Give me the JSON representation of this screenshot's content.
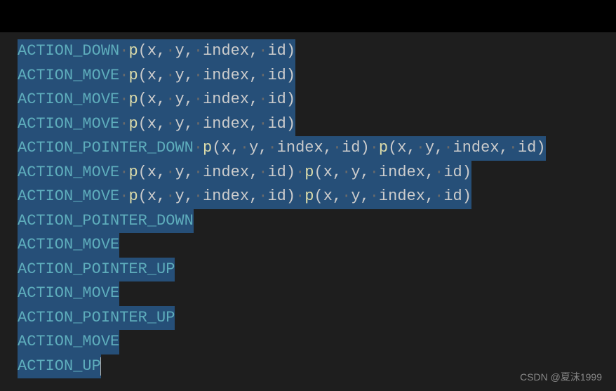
{
  "lines": [
    {
      "tokens": [
        {
          "t": "action",
          "v": "ACTION_DOWN"
        },
        {
          "t": "sp"
        },
        {
          "t": "p",
          "v": "p"
        },
        {
          "t": "params",
          "v": "(x,"
        },
        {
          "t": "sp"
        },
        {
          "t": "params",
          "v": "y,"
        },
        {
          "t": "sp"
        },
        {
          "t": "params",
          "v": "index,"
        },
        {
          "t": "sp"
        },
        {
          "t": "params",
          "v": "id)"
        }
      ]
    },
    {
      "tokens": [
        {
          "t": "action",
          "v": "ACTION_MOVE"
        },
        {
          "t": "sp"
        },
        {
          "t": "p",
          "v": "p"
        },
        {
          "t": "params",
          "v": "(x,"
        },
        {
          "t": "sp"
        },
        {
          "t": "params",
          "v": "y,"
        },
        {
          "t": "sp"
        },
        {
          "t": "params",
          "v": "index,"
        },
        {
          "t": "sp"
        },
        {
          "t": "params",
          "v": "id)"
        }
      ]
    },
    {
      "tokens": [
        {
          "t": "action",
          "v": "ACTION_MOVE"
        },
        {
          "t": "sp"
        },
        {
          "t": "p",
          "v": "p"
        },
        {
          "t": "params",
          "v": "(x,"
        },
        {
          "t": "sp"
        },
        {
          "t": "params",
          "v": "y,"
        },
        {
          "t": "sp"
        },
        {
          "t": "params",
          "v": "index,"
        },
        {
          "t": "sp"
        },
        {
          "t": "params",
          "v": "id)"
        }
      ]
    },
    {
      "tokens": [
        {
          "t": "action",
          "v": "ACTION_MOVE"
        },
        {
          "t": "sp"
        },
        {
          "t": "p",
          "v": "p"
        },
        {
          "t": "params",
          "v": "(x,"
        },
        {
          "t": "sp"
        },
        {
          "t": "params",
          "v": "y,"
        },
        {
          "t": "sp"
        },
        {
          "t": "params",
          "v": "index,"
        },
        {
          "t": "sp"
        },
        {
          "t": "params",
          "v": "id)"
        }
      ]
    },
    {
      "tokens": [
        {
          "t": "action",
          "v": "ACTION_POINTER_DOWN"
        },
        {
          "t": "sp"
        },
        {
          "t": "p",
          "v": "p"
        },
        {
          "t": "params",
          "v": "(x,"
        },
        {
          "t": "sp"
        },
        {
          "t": "params",
          "v": "y,"
        },
        {
          "t": "sp"
        },
        {
          "t": "params",
          "v": "index,"
        },
        {
          "t": "sp"
        },
        {
          "t": "params",
          "v": "id)"
        },
        {
          "t": "sp"
        },
        {
          "t": "p",
          "v": "p"
        },
        {
          "t": "params",
          "v": "(x,"
        },
        {
          "t": "sp"
        },
        {
          "t": "params",
          "v": "y,"
        },
        {
          "t": "sp"
        },
        {
          "t": "params",
          "v": "index,"
        },
        {
          "t": "sp"
        },
        {
          "t": "params",
          "v": "id)"
        }
      ]
    },
    {
      "tokens": [
        {
          "t": "action",
          "v": "ACTION_MOVE"
        },
        {
          "t": "sp"
        },
        {
          "t": "p",
          "v": "p"
        },
        {
          "t": "params",
          "v": "(x,"
        },
        {
          "t": "sp"
        },
        {
          "t": "params",
          "v": "y,"
        },
        {
          "t": "sp"
        },
        {
          "t": "params",
          "v": "index,"
        },
        {
          "t": "sp"
        },
        {
          "t": "params",
          "v": "id)"
        },
        {
          "t": "sp"
        },
        {
          "t": "p",
          "v": "p"
        },
        {
          "t": "params",
          "v": "(x,"
        },
        {
          "t": "sp"
        },
        {
          "t": "params",
          "v": "y,"
        },
        {
          "t": "sp"
        },
        {
          "t": "params",
          "v": "index,"
        },
        {
          "t": "sp"
        },
        {
          "t": "params",
          "v": "id)"
        }
      ]
    },
    {
      "tokens": [
        {
          "t": "action",
          "v": "ACTION_MOVE"
        },
        {
          "t": "sp"
        },
        {
          "t": "p",
          "v": "p"
        },
        {
          "t": "params",
          "v": "(x,"
        },
        {
          "t": "sp"
        },
        {
          "t": "params",
          "v": "y,"
        },
        {
          "t": "sp"
        },
        {
          "t": "params",
          "v": "index,"
        },
        {
          "t": "sp"
        },
        {
          "t": "params",
          "v": "id)"
        },
        {
          "t": "sp"
        },
        {
          "t": "p",
          "v": "p"
        },
        {
          "t": "params",
          "v": "(x,"
        },
        {
          "t": "sp"
        },
        {
          "t": "params",
          "v": "y,"
        },
        {
          "t": "sp"
        },
        {
          "t": "params",
          "v": "index,"
        },
        {
          "t": "sp"
        },
        {
          "t": "params",
          "v": "id)"
        }
      ]
    },
    {
      "tokens": [
        {
          "t": "action",
          "v": "ACTION_POINTER_DOWN"
        }
      ]
    },
    {
      "tokens": [
        {
          "t": "action",
          "v": "ACTION_MOVE"
        }
      ]
    },
    {
      "tokens": [
        {
          "t": "action",
          "v": "ACTION_POINTER_UP"
        }
      ]
    },
    {
      "tokens": [
        {
          "t": "action",
          "v": "ACTION_MOVE"
        }
      ]
    },
    {
      "tokens": [
        {
          "t": "action",
          "v": "ACTION_POINTER_UP"
        }
      ]
    },
    {
      "tokens": [
        {
          "t": "action",
          "v": "ACTION_MOVE"
        }
      ]
    },
    {
      "tokens": [
        {
          "t": "action",
          "v": "ACTION_UP"
        }
      ],
      "cursor": true
    }
  ],
  "watermark": "CSDN @夏沫1999"
}
